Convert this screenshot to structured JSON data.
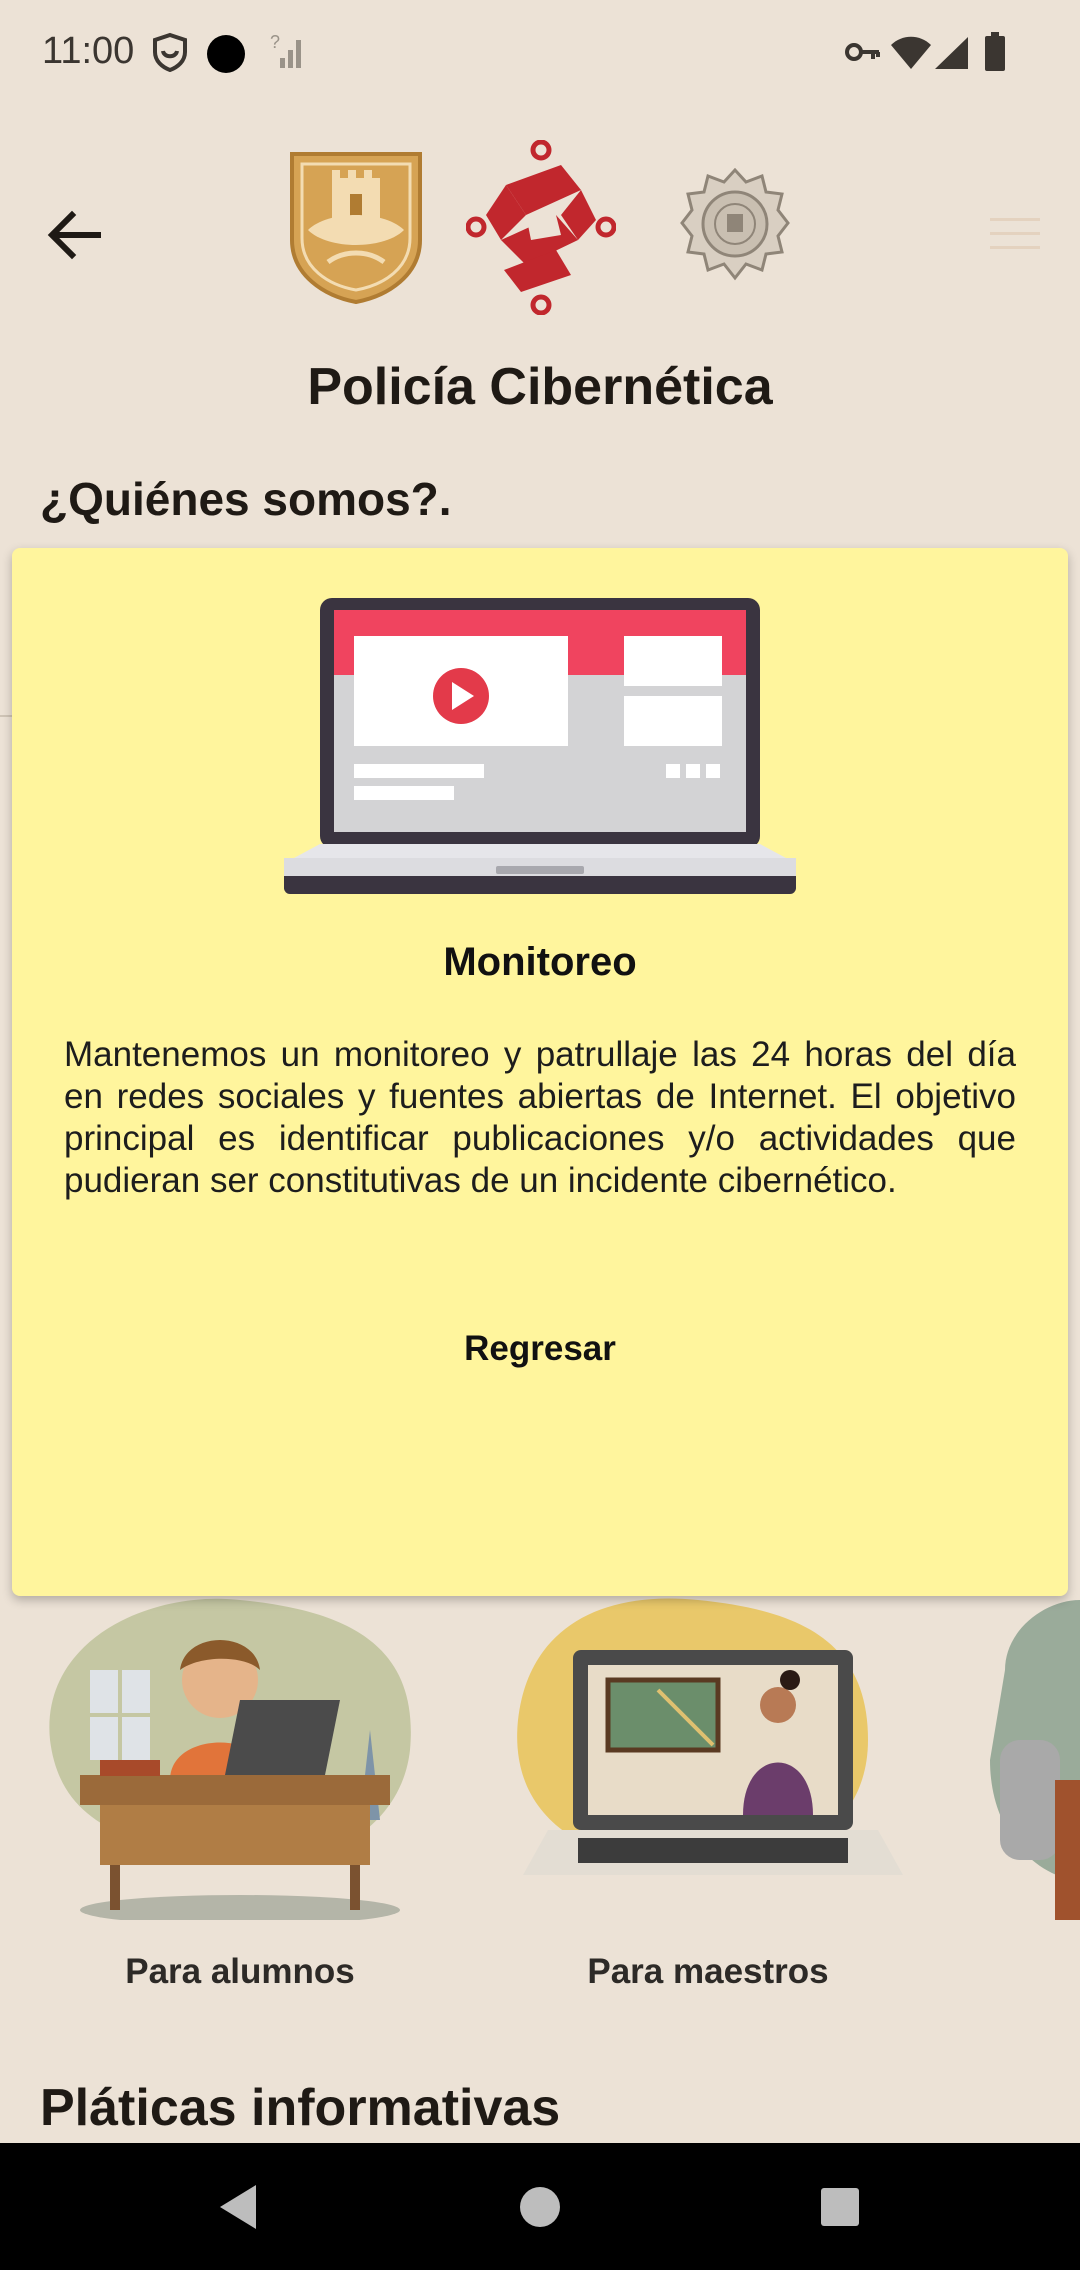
{
  "status": {
    "time": "11:00",
    "icons": [
      "shield-app-icon",
      "camera-dot-icon",
      "no-signal-icon",
      "vpn-key-icon",
      "wifi-icon",
      "cell-signal-icon",
      "battery-icon"
    ]
  },
  "appbar": {
    "back_icon": "arrow-back-icon",
    "logos": [
      "cdmx-shield-logo",
      "cdmx-emblem-logo",
      "ssc-police-seal-logo"
    ],
    "menu_icon": "hamburger-menu-icon"
  },
  "page": {
    "title": "Policía Cibernética",
    "section_quienes": "¿Quiénes somos?.",
    "section_platicas": "Pláticas informativas"
  },
  "cards": [
    {
      "label": "Para alumnos"
    },
    {
      "label": "Para maestros"
    }
  ],
  "dialog": {
    "title": "Monitoreo",
    "body": "Mantenemos un monitoreo y patrullaje las 24 horas del día en redes sociales y fuentes abiertas de Internet. El objetivo principal es identificar publicaciones y/o actividades que pudieran ser constitutivas de un incidente cibernético.",
    "button": "Regresar"
  },
  "navbar": {
    "icons": [
      "nav-back-icon",
      "nav-home-icon",
      "nav-recents-icon"
    ]
  },
  "colors": {
    "background": "#ece2d6",
    "dialog": "#fff59d",
    "brand_red": "#c1272d",
    "brand_gold": "#d6a354"
  }
}
